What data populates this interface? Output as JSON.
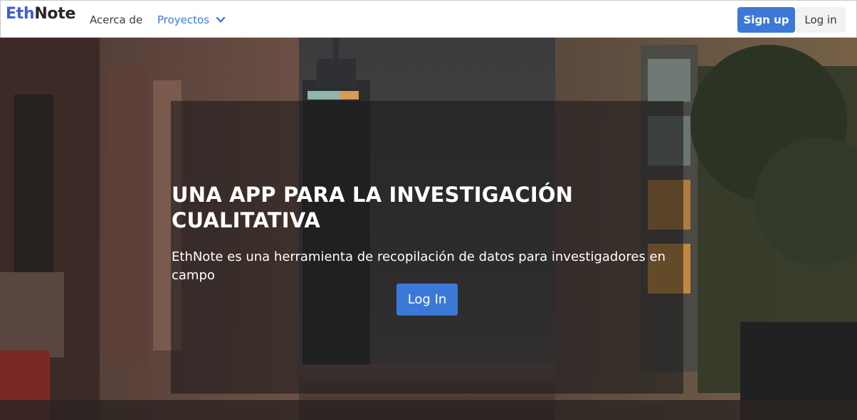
{
  "navbar": {
    "brand_part1": "Eth",
    "brand_part2": "Note",
    "about_label": "Acerca de",
    "projects_label": "Proyectos",
    "signup_label": "Sign up",
    "login_label": "Log in"
  },
  "hero": {
    "title_line1": "UNA APP PARA LA INVESTIGACIÓN",
    "title_line2": "CUALITATIVA",
    "subtitle": "EthNote es una herramienta de recopilación de datos para investigadores en campo",
    "login_button_label": "Log In"
  },
  "colors": {
    "brand_blue": "#3e5fd6",
    "primary_button": "#3c78d8",
    "link_blue": "#3c78d8",
    "overlay": "rgba(22,22,24,0.55)"
  },
  "icons": {
    "projects_dropdown": "chevron-down-icon"
  }
}
